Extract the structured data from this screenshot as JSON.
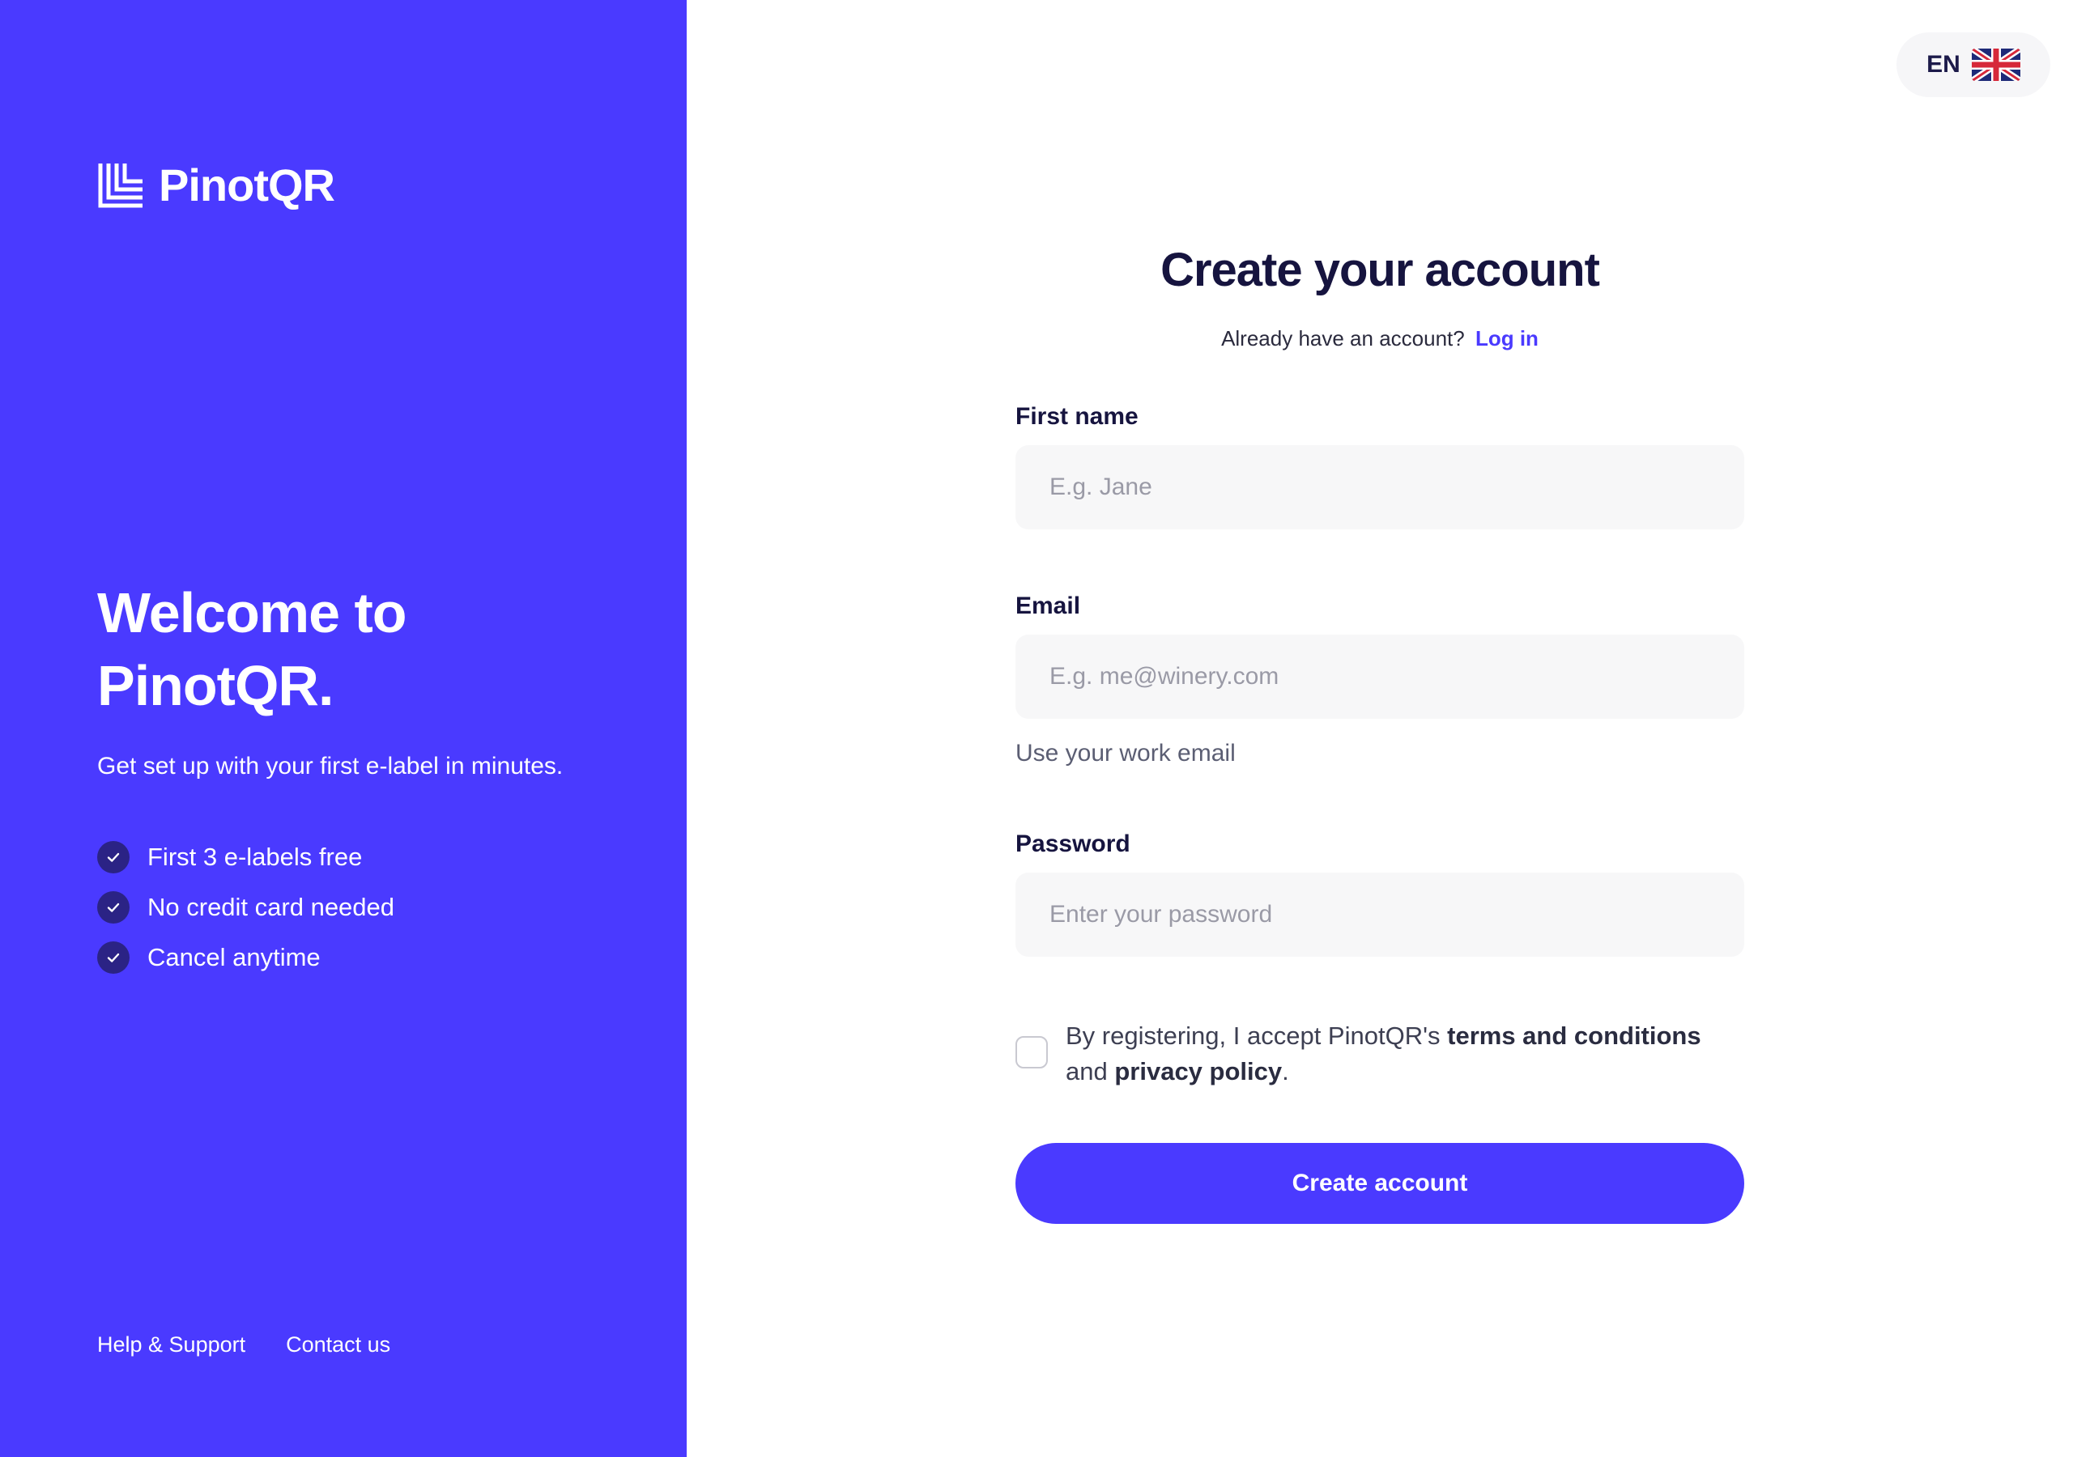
{
  "brand": {
    "name": "PinotQR",
    "logo_icon": "pinotqr-logo-icon",
    "color": "#4a3aff"
  },
  "welcome": {
    "line1": "Welcome to",
    "line2": "PinotQR.",
    "tagline": "Get set up with your first e-label in minutes."
  },
  "benefits": [
    {
      "label": "First 3 e-labels free",
      "icon": "check-icon"
    },
    {
      "label": "No credit card needed",
      "icon": "check-icon"
    },
    {
      "label": "Cancel anytime",
      "icon": "check-icon"
    }
  ],
  "footer": {
    "help_label": "Help & Support",
    "contact_label": "Contact us"
  },
  "language": {
    "code": "EN",
    "flag_icon": "uk-flag-icon"
  },
  "form": {
    "title": "Create your account",
    "login_prompt": "Already have an account?",
    "login_link": "Log in",
    "first_name": {
      "label": "First name",
      "placeholder": "E.g. Jane",
      "value": ""
    },
    "email": {
      "label": "Email",
      "placeholder": "E.g. me@winery.com",
      "value": "",
      "hint": "Use your work email"
    },
    "password": {
      "label": "Password",
      "placeholder": "Enter your password",
      "value": ""
    },
    "terms": {
      "prefix": "By registering, I accept PinotQR's ",
      "terms_link": "terms and conditions",
      "middle": " and ",
      "privacy_link": "privacy policy",
      "suffix": ".",
      "checked": false
    },
    "submit_label": "Create account"
  }
}
